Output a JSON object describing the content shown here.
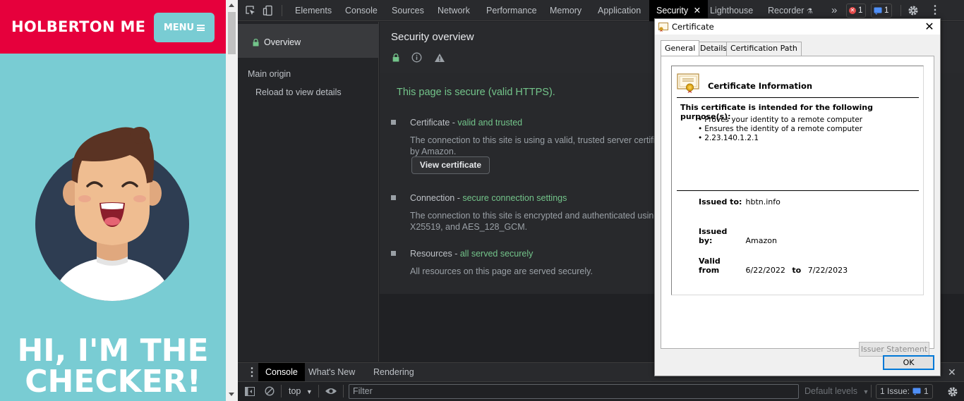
{
  "website": {
    "logo": "HOLBERTON ME",
    "menu_label": "MENU",
    "hero_title_line1": "HI, I'M THE",
    "hero_title_line2": "CHECKER!",
    "colors": {
      "header": "#e6003c",
      "background": "#79ccd3",
      "avatar_circle": "#2e3d52"
    }
  },
  "devtools": {
    "tabs": [
      "Elements",
      "Console",
      "Sources",
      "Network",
      "Performance",
      "Memory",
      "Application",
      "Security",
      "Lighthouse",
      "Recorder"
    ],
    "active_tab": "Security",
    "error_count": "1",
    "issue_count": "1",
    "sidebar": {
      "overview": "Overview",
      "main_origin": "Main origin",
      "reload": "Reload to view details"
    },
    "security": {
      "title": "Security overview",
      "summary": "This page is secure (valid HTTPS).",
      "certificate": {
        "label": "Certificate - ",
        "status": "valid and trusted",
        "desc": "The connection to this site is using a valid, trusted server certificat",
        "desc2": "by Amazon.",
        "button": "View certificate"
      },
      "connection": {
        "label": "Connection - ",
        "status": "secure connection settings",
        "desc": "The connection to this site is encrypted and authenticated using T",
        "desc2": "X25519, and AES_128_GCM."
      },
      "resources": {
        "label": "Resources - ",
        "status": "all served securely",
        "desc": "All resources on this page are served securely."
      }
    },
    "drawer": {
      "tabs": [
        "Console",
        "What's New",
        "Rendering"
      ],
      "active": "Console",
      "context": "top",
      "filter_placeholder": "Filter",
      "levels": "Default levels",
      "issues_label": "1 Issue:",
      "issues_count": "1"
    }
  },
  "certificate_dialog": {
    "title": "Certificate",
    "tabs": [
      "General",
      "Details",
      "Certification Path"
    ],
    "info_title": "Certificate Information",
    "purpose_heading": "This certificate is intended for the following purpose(s):",
    "purposes": [
      "Proves your identity to a remote computer",
      "Ensures the identity of a remote computer",
      "2.23.140.1.2.1"
    ],
    "issued_to_label": "Issued to:",
    "issued_to": "hbtn.info",
    "issued_by_label": "Issued by:",
    "issued_by": "Amazon",
    "valid_from_label": "Valid from",
    "valid_from": "6/22/2022",
    "to_label": "to",
    "valid_to": "7/22/2023",
    "issuer_statement": "Issuer Statement",
    "ok": "OK"
  }
}
